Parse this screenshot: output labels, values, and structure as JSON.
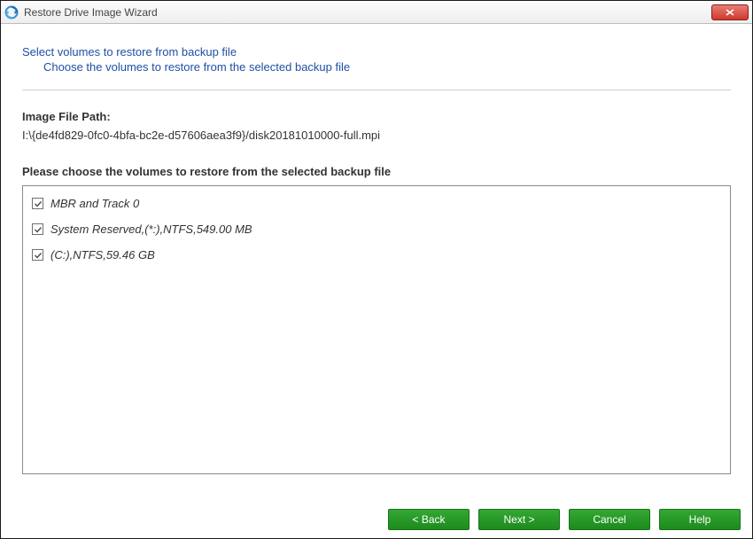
{
  "window": {
    "title": "Restore Drive Image Wizard"
  },
  "intro": {
    "title": "Select volumes to restore from backup file",
    "subtitle": "Choose the volumes to restore from the selected backup file"
  },
  "image_path": {
    "label": "Image File Path:",
    "value": "I:\\{de4fd829-0fc0-4bfa-bc2e-d57606aea3f9}/disk20181010000-full.mpi"
  },
  "volumes": {
    "label": "Please choose the volumes to restore from the selected backup file",
    "items": [
      {
        "checked": true,
        "label": "MBR and Track 0"
      },
      {
        "checked": true,
        "label": "System Reserved,(*:),NTFS,549.00 MB"
      },
      {
        "checked": true,
        "label": "(C:),NTFS,59.46 GB"
      }
    ]
  },
  "buttons": {
    "back": "< Back",
    "next": "Next >",
    "cancel": "Cancel",
    "help": "Help"
  }
}
